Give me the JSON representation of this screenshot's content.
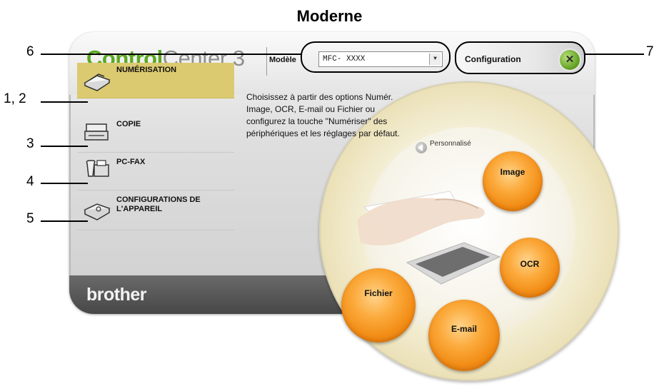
{
  "figure": {
    "title": "Moderne"
  },
  "callouts": {
    "c12": "1, 2",
    "c3": "3",
    "c4": "4",
    "c5": "5",
    "c6": "6",
    "c7": "7"
  },
  "app": {
    "logo_part1": "Control",
    "logo_part2": "Center 3",
    "brand": "brother"
  },
  "model": {
    "label": "Modèle",
    "selected": "MFC- XXXX"
  },
  "configuration": {
    "label": "Configuration",
    "icon": "exit-icon"
  },
  "sidebar": {
    "items": [
      {
        "label": "NUMÉRISATION",
        "icon": "scanner-icon",
        "selected": true
      },
      {
        "label": "COPIE",
        "icon": "copier-icon",
        "selected": false
      },
      {
        "label": "PC-FAX",
        "icon": "fax-icon",
        "selected": false
      },
      {
        "label": "CONFIGURATIONS DE L'APPAREIL",
        "icon": "device-settings-icon",
        "selected": false
      }
    ]
  },
  "main": {
    "description": "Choisissez à partir des options Numér. Image, OCR, E-mail ou Fichier ou configurez la touche \"Numériser\" des périphériques et les réglages par défaut.",
    "custom_label": "Personnalisé",
    "buttons": {
      "image": "Image",
      "ocr": "OCR",
      "email": "E-mail",
      "file": "Fichier"
    }
  },
  "colors": {
    "accent_green": "#5aa820",
    "selected_bg": "#dcca70",
    "orange_button": "#f28d16"
  }
}
